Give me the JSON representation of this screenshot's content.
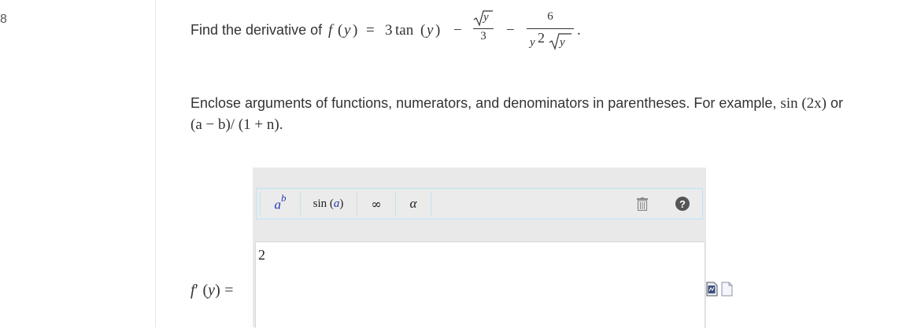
{
  "question": {
    "number": "8",
    "lead_text": "Find the derivative of",
    "func": "f",
    "var": "y",
    "eq": "=",
    "term1_coef": "3",
    "term1_fn": "tan",
    "minus": "−",
    "frac1_num_var": "y",
    "frac1_den": "3",
    "frac2_num": "6",
    "frac2_den_var": "y",
    "frac2_den_exp": "2",
    "period": "."
  },
  "instructions": {
    "line1_text": "Enclose arguments of functions, numerators, and denominators in parentheses. For example,",
    "line1_example": "sin (2x)",
    "line1_or": "or",
    "line2_example": "(a − b)/ (1 + n)."
  },
  "toolbar": {
    "power_base": "a",
    "power_exp": "b",
    "sin_fn": "sin",
    "sin_arg": "a",
    "infinity": "∞",
    "alpha": "α",
    "help": "?"
  },
  "answer": {
    "label_func": "f",
    "label_prime": "′",
    "label_var": "y",
    "label_eq": "=",
    "value": "2"
  },
  "icons": {
    "trash": "trash-icon",
    "help": "help-icon",
    "preview": "preview-document-icon",
    "blank": "blank-document-icon"
  },
  "colors": {
    "toolbar_accent": "#1f35b5",
    "toolbar_border": "#c6e1ec",
    "editor_bg": "#e9e9e9"
  }
}
